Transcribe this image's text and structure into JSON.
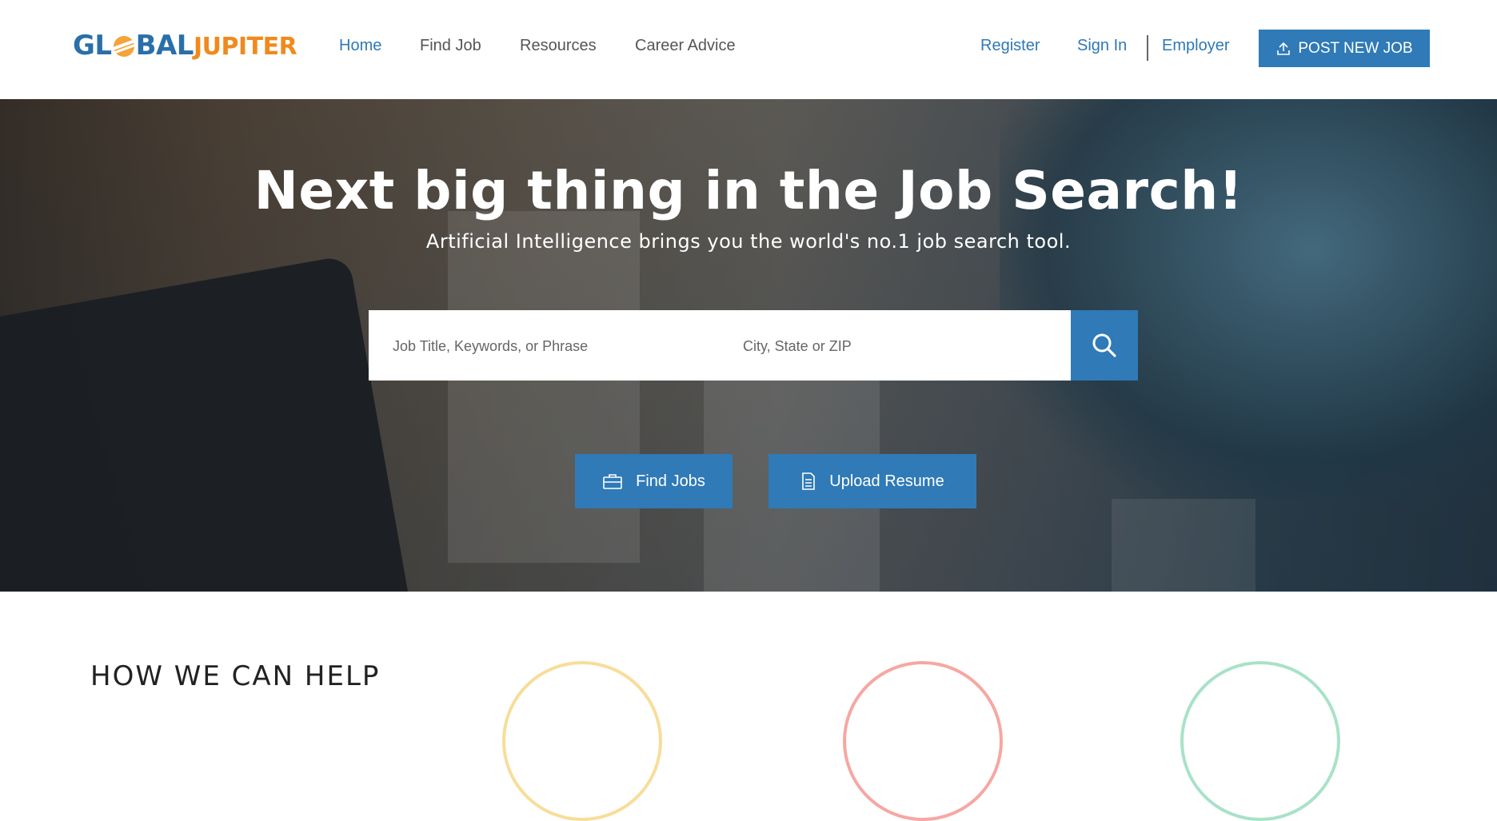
{
  "brand": {
    "logo_part1": "GL",
    "logo_part2": "BAL",
    "logo_part3": "JUPITER"
  },
  "nav": {
    "home": "Home",
    "find_job": "Find Job",
    "resources": "Resources",
    "career_advice": "Career Advice",
    "register": "Register",
    "sign_in": "Sign In",
    "employer": "Employer",
    "post_job": "POST NEW JOB"
  },
  "hero": {
    "title": "Next big thing in the Job Search!",
    "subtitle": "Artificial Intelligence brings you the world's no.1 job search tool."
  },
  "search": {
    "keywords_placeholder": "Job Title, Keywords, or Phrase",
    "location_placeholder": "City, State or ZIP",
    "keywords_value": "",
    "location_value": ""
  },
  "actions": {
    "find_jobs": "Find Jobs",
    "upload_resume": "Upload Resume"
  },
  "help": {
    "heading": "HOW WE CAN HELP"
  },
  "icons": {
    "post": "upload-icon",
    "search": "search-icon",
    "find_jobs": "briefcase-icon",
    "upload_resume": "document-icon"
  },
  "colors": {
    "primary": "#2f7ab7",
    "logo_orange": "#f08a1c",
    "logo_blue": "#2b6fa8",
    "circle_yellow": "#f8dd9a",
    "circle_red": "#f6a7a2",
    "circle_green": "#a8e2c8"
  }
}
